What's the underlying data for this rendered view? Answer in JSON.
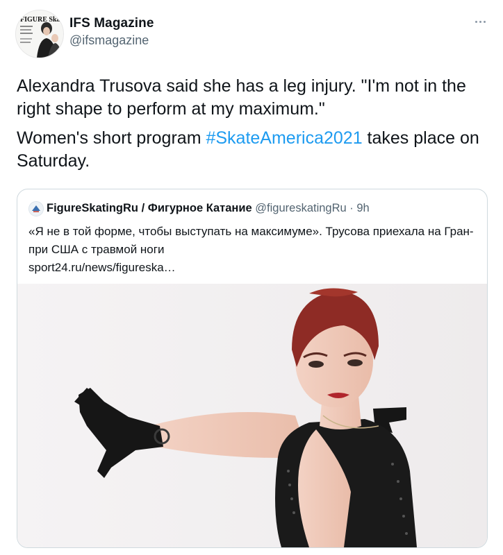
{
  "tweet": {
    "author": {
      "name": "IFS Magazine",
      "handle": "@ifsmagazine",
      "avatar_text": "FIGURE Skating"
    },
    "more_icon": "more-horizontal-icon",
    "text_1": "Alexandra Trusova said she has a leg injury. \"I'm not in the right shape to perform at my maximum.\"",
    "text_2_before": "Women's short program ",
    "text_2_hashtag": "#SkateAmerica2021",
    "text_2_after": " takes place on Saturday.",
    "quote": {
      "author_name": "FigureSkatingRu / Фигурное Катание",
      "author_handle": "@figureskatingRu",
      "separator": " · ",
      "time": "9h",
      "text": "«Я не в той форме, чтобы выступать на максимуме». Трусова приехала на Гран-при США с травмой ноги",
      "link": "sport24.ru/news/figureska…"
    }
  }
}
